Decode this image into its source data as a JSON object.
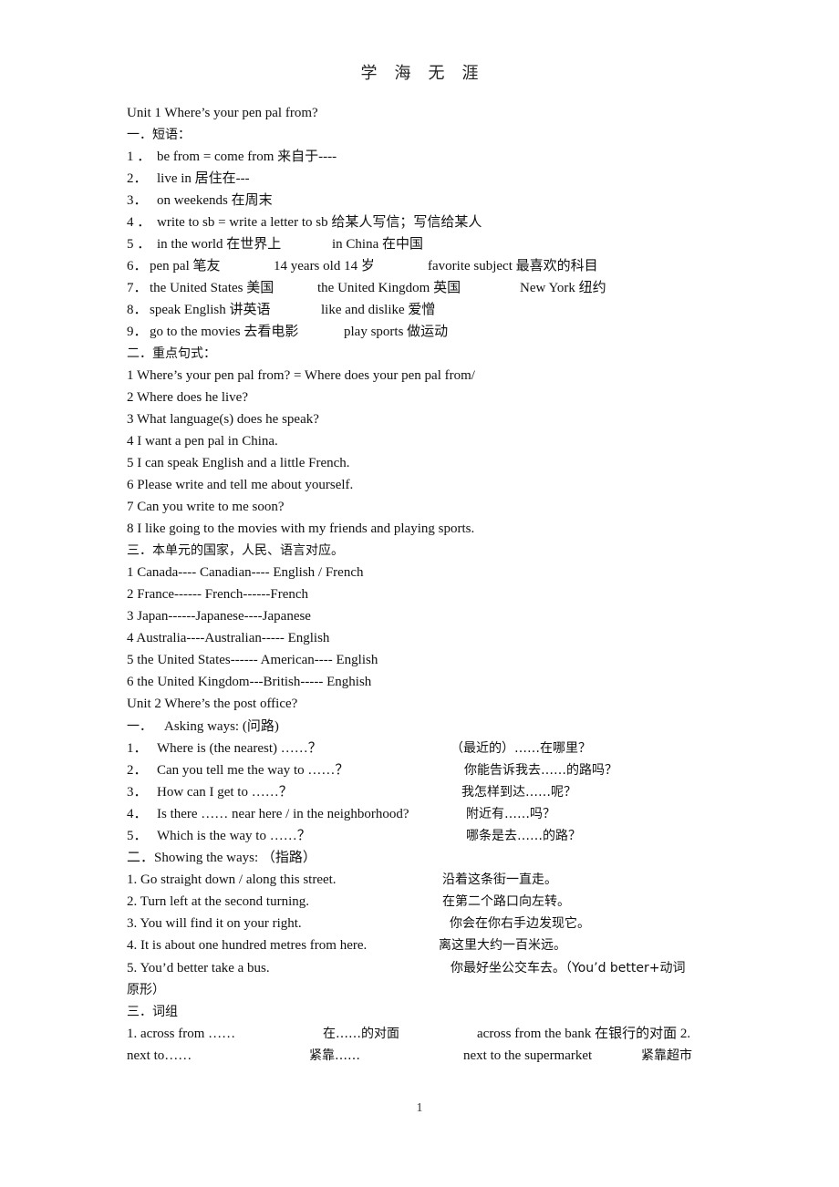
{
  "header": {
    "title": "学海无涯"
  },
  "unit1": {
    "title": "Unit 1 Where’s your pen pal from?",
    "section1": {
      "heading": "一．短语：",
      "phrases": [
        {
          "num": "1 ．",
          "text": "be from = come from  来自于----"
        },
        {
          "num": "2．",
          "text": "live in  居住在---"
        },
        {
          "num": "3．",
          "text": "on weekends  在周末"
        },
        {
          "num": "4 ．",
          "text": "write to sb = write a letter to sb  给某人写信；写信给某人"
        },
        {
          "num": "5 ．",
          "col1": "in the world  在世界上",
          "col2": "in China  在中国"
        },
        {
          "num": "6．",
          "col1": "pen pal  笔友",
          "col2": "14 years old 14 岁",
          "col3": "favorite subject  最喜欢的科目"
        },
        {
          "num": "7．",
          "col1": "the United States  美国",
          "col2": "the United Kingdom  英国",
          "col3": "New York  纽约"
        },
        {
          "num": "8．",
          "col1": "speak English  讲英语",
          "col2": "like and dislike  爱憎"
        },
        {
          "num": "9．",
          "col1": "go to the movies  去看电影",
          "col2": "play sports  做运动"
        }
      ]
    },
    "section2": {
      "heading": "二．重点句式：",
      "sentences": [
        "1 Where’s your pen pal from? = Where does your pen pal from/",
        "2 Where does he live?",
        "3 What language(s) does he speak?",
        "4 I want a pen pal in China.",
        "5 I can speak English and a little French.",
        "6 Please write and tell me about yourself.",
        "7 Can you write to me soon?",
        "8 I like going to the movies with my friends and playing sports."
      ]
    },
    "section3": {
      "heading": "三．本单元的国家，人民、语言对应。",
      "items": [
        "1 Canada---- Canadian---- English / French",
        "2 France------ French------French",
        "3 Japan------Japanese----Japanese",
        "4 Australia----Australian----- English",
        "5 the United States------ American---- English",
        "6 the United Kingdom---British----- Enghish"
      ]
    }
  },
  "unit2": {
    "title": "Unit 2 Where’s the post office?",
    "section1": {
      "heading_num": "一．",
      "heading": "Asking ways: (问路)",
      "items": [
        {
          "num": "1．",
          "en": "Where is (the nearest)  ……？",
          "cn": "（最近的）……在哪里？"
        },
        {
          "num": "2．",
          "en": "Can you tell me the way to  ……？",
          "cn": "你能告诉我去……的路吗？"
        },
        {
          "num": "3．",
          "en": "How can I get to  ……？",
          "cn": "我怎样到达……呢？"
        },
        {
          "num": "4．",
          "en": "Is there  ……  near here / in the neighborhood?",
          "cn": "附近有……吗？"
        },
        {
          "num": "5．",
          "en": "Which is the way to  ……？",
          "cn": "哪条是去……的路？"
        }
      ]
    },
    "section2": {
      "heading": "二．Showing the ways:  （指路）",
      "items": [
        {
          "en": "1. Go straight down / along this street.",
          "cn": "沿着这条街一直走。"
        },
        {
          "en": "2. Turn left at the second turning.",
          "cn": "在第二个路口向左转。"
        },
        {
          "en": "3. You will find it on your right.",
          "cn": "你会在你右手边发现它。"
        },
        {
          "en": "4. It is about one hundred metres from here.",
          "cn": "离这里大约一百米远。"
        },
        {
          "en": "5. You’d better take a bus.",
          "cn": "你最好坐公交车去。（You’d better+动词",
          "cn_cont": "原形）"
        }
      ]
    },
    "section3": {
      "heading": "三．词组",
      "row1": {
        "a": "1. across from  ……",
        "b": "在……的对面",
        "c": "across from the bank  在银行的对面 2."
      },
      "row2": {
        "a": "next to……",
        "b": "紧靠……",
        "c": "next to the supermarket",
        "d": "紧靠超市"
      }
    }
  },
  "footer": {
    "page_number": "1"
  }
}
